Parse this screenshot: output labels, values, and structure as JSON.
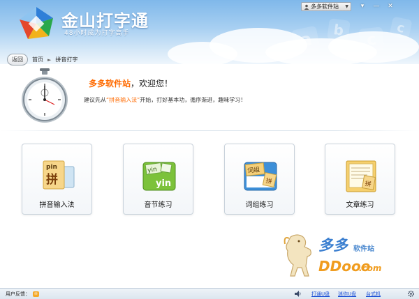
{
  "window": {
    "app_title": "金山打字通",
    "slogan": "48小时成为打字高手",
    "user_name": "多多软件站",
    "controls": [
      "▾",
      "—",
      "✕"
    ]
  },
  "nav": {
    "back_label": "返回",
    "breadcrumb": [
      "首页",
      "拼音打字"
    ]
  },
  "welcome": {
    "name": "多多软件站",
    "greeting": "，欢迎您！",
    "advice_prefix": "建议先从",
    "advice_highlight": "“拼音输入法”",
    "advice_suffix": "开始，打好基本功，循序渐进，趣味学习！"
  },
  "cards": [
    {
      "label": "拼音输入法",
      "icon": "pinyin-card-icon",
      "glyph_top": "pin",
      "glyph_main": "拼"
    },
    {
      "label": "音节练习",
      "icon": "syllable-book-icon",
      "glyph_top": "yin",
      "glyph_main": "yin"
    },
    {
      "label": "词组练习",
      "icon": "phrase-book-icon",
      "glyph_top": "词组",
      "glyph_main": "拼"
    },
    {
      "label": "文章练习",
      "icon": "article-paper-icon",
      "glyph_top": "",
      "glyph_main": "拼"
    }
  ],
  "watermark": {
    "cn": "多多",
    "cn_suffix": "软件站",
    "en": "DDooo",
    "en_suffix": ".com"
  },
  "status": {
    "feedback_label": "用户反馈：",
    "links": [
      "打通U盘",
      "迷你U盘",
      "台式机"
    ]
  },
  "colors": {
    "accent": "#ff6a00",
    "link": "#1a4fd6",
    "header_top": "#7fb8ea"
  }
}
